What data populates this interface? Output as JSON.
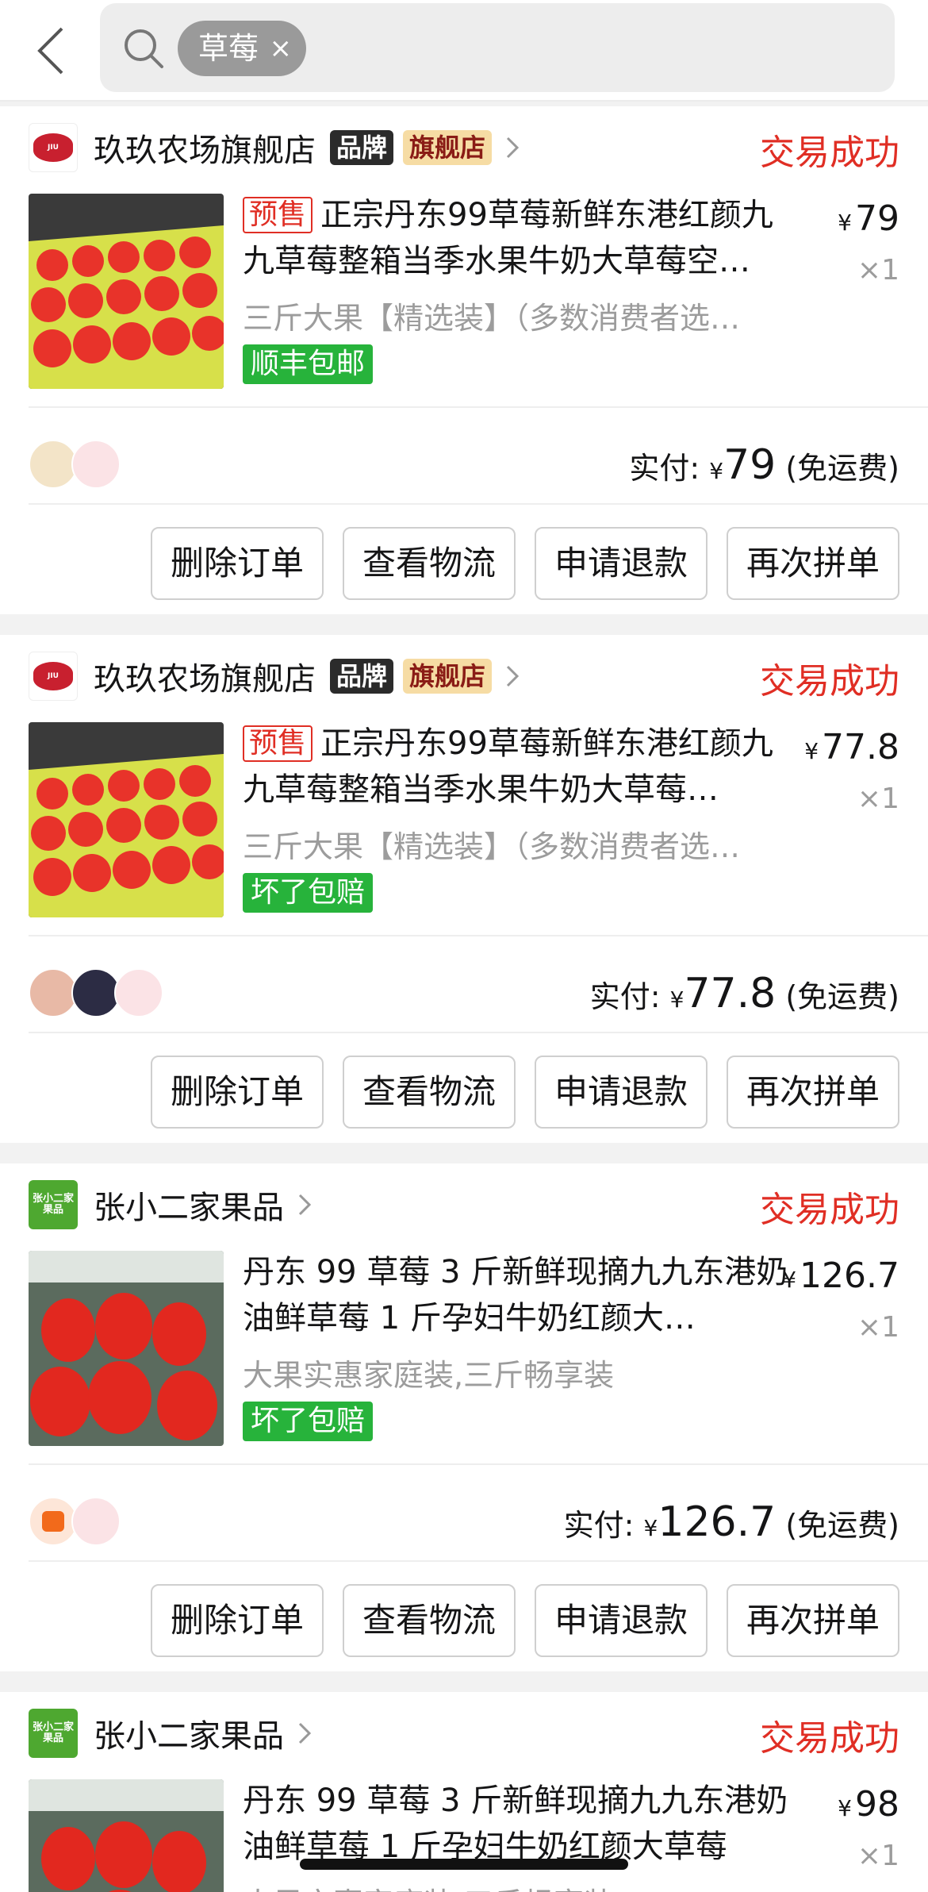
{
  "search": {
    "chip_label": "草莓",
    "chip_close": "×"
  },
  "orders": [
    {
      "shop": "玖玖农场旗舰店",
      "badges": [
        "品牌",
        "旗舰店"
      ],
      "status": "交易成功",
      "presale": "预售",
      "title": "正宗丹东99草莓新鲜东港红颜九九草莓整箱当季水果牛奶大草莓空…",
      "spec": "三斤大果【精选装】（多数消费者选…",
      "tag": "顺丰包邮",
      "price_symbol": "¥",
      "price": "79",
      "qty": "×1",
      "paid_label": "实付:",
      "paid_symbol": "¥",
      "paid_amount": "79",
      "shipping": "(免运费)",
      "buttons": [
        "删除订单",
        "查看物流",
        "申请退款",
        "再次拼单"
      ]
    },
    {
      "shop": "玖玖农场旗舰店",
      "badges": [
        "品牌",
        "旗舰店"
      ],
      "status": "交易成功",
      "presale": "预售",
      "title": "正宗丹东99草莓新鲜东港红颜九九草莓整箱当季水果牛奶大草莓…",
      "spec": "三斤大果【精选装】（多数消费者选…",
      "tag": "坏了包赔",
      "price_symbol": "¥",
      "price": "77.8",
      "qty": "×1",
      "paid_label": "实付:",
      "paid_symbol": "¥",
      "paid_amount": "77.8",
      "shipping": "(免运费)",
      "buttons": [
        "删除订单",
        "查看物流",
        "申请退款",
        "再次拼单"
      ]
    },
    {
      "shop": "张小二家果品",
      "logo_text": "张小二家果品",
      "status": "交易成功",
      "title": "丹东 99 草莓 3 斤新鲜现摘九九东港奶油鲜草莓 1 斤孕妇牛奶红颜大…",
      "spec": "大果实惠家庭装,三斤畅享装",
      "tag": "坏了包赔",
      "price_symbol": "¥",
      "price": "126.7",
      "qty": "×1",
      "paid_label": "实付:",
      "paid_symbol": "¥",
      "paid_amount": "126.7",
      "shipping": "(免运费)",
      "buttons": [
        "删除订单",
        "查看物流",
        "申请退款",
        "再次拼单"
      ]
    },
    {
      "shop": "张小二家果品",
      "logo_text": "张小二家果品",
      "status": "交易成功",
      "title": "丹东 99 草莓 3 斤新鲜现摘九九东港奶油鲜草莓 1 斤孕妇牛奶红颜大草莓",
      "spec": "大果实惠家庭装,三斤畅享装",
      "price_symbol": "¥",
      "price": "98",
      "qty": "×1"
    }
  ],
  "colors": {
    "accent": "#e02e24",
    "tag_green": "#27b33b",
    "badge_gold": "#f6dca4"
  }
}
